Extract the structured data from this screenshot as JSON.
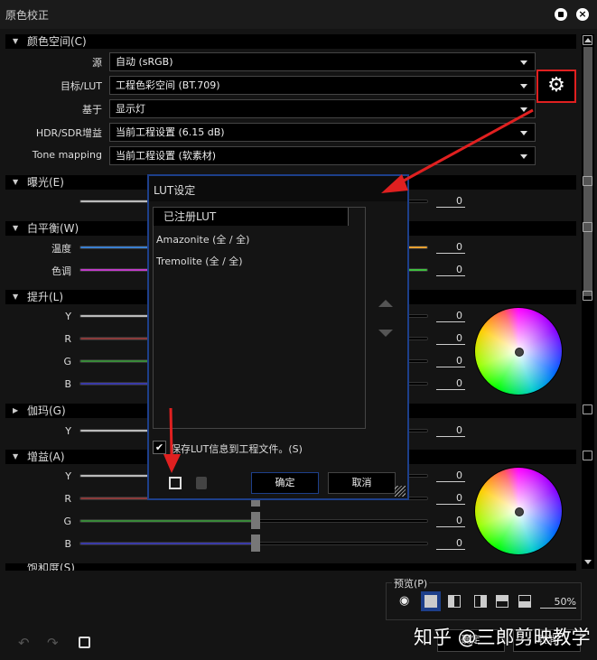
{
  "window": {
    "title": "原色校正",
    "icons": [
      "record-icon",
      "close-icon"
    ]
  },
  "color_space": {
    "header": "颜色空间(C)",
    "rows": [
      {
        "label": "源",
        "value": "自动 (sRGB)"
      },
      {
        "label": "目标/LUT",
        "value": "工程色彩空间 (BT.709)"
      },
      {
        "label": "基于",
        "value": "显示灯"
      },
      {
        "label": "HDR/SDR增益",
        "value": "当前工程设置 (6.15 dB)"
      },
      {
        "label": "Tone mapping",
        "value": "当前工程设置 (软素材)"
      }
    ]
  },
  "exposure": {
    "header": "曝光(E)",
    "value": "0"
  },
  "white_balance": {
    "header": "白平衡(W)",
    "rows": [
      {
        "label": "温度",
        "value": "0"
      },
      {
        "label": "色调",
        "value": "0"
      }
    ]
  },
  "lift": {
    "header": "提升(L)",
    "rows": [
      {
        "label": "Y",
        "value": "0"
      },
      {
        "label": "R",
        "value": "0"
      },
      {
        "label": "G",
        "value": "0"
      },
      {
        "label": "B",
        "value": "0"
      }
    ]
  },
  "gamma": {
    "header": "伽玛(G)",
    "rows": [
      {
        "label": "Y",
        "value": "0"
      }
    ]
  },
  "gain": {
    "header": "增益(A)",
    "rows": [
      {
        "label": "Y",
        "value": "0"
      },
      {
        "label": "R",
        "value": "0"
      },
      {
        "label": "G",
        "value": "0"
      },
      {
        "label": "B",
        "value": "0"
      }
    ]
  },
  "saturation": {
    "header": "饱和度(S)"
  },
  "lut_dialog": {
    "title": "LUT设定",
    "list_header": "已注册LUT",
    "items": [
      "Amazonite (全 / 全)",
      "Tremolite (全 / 全)"
    ],
    "save_checkbox": "保存LUT信息到工程文件。(S)",
    "save_checked": true,
    "ok": "确定",
    "cancel": "取消"
  },
  "preview": {
    "label": "预览(P)",
    "percent": "50%"
  },
  "footer": {
    "ok": "确定",
    "cancel": "取消"
  },
  "watermark": "知乎 @三郎剪映教学",
  "colors": {
    "accent": "#1d3f8a",
    "annotation": "#e02020"
  }
}
